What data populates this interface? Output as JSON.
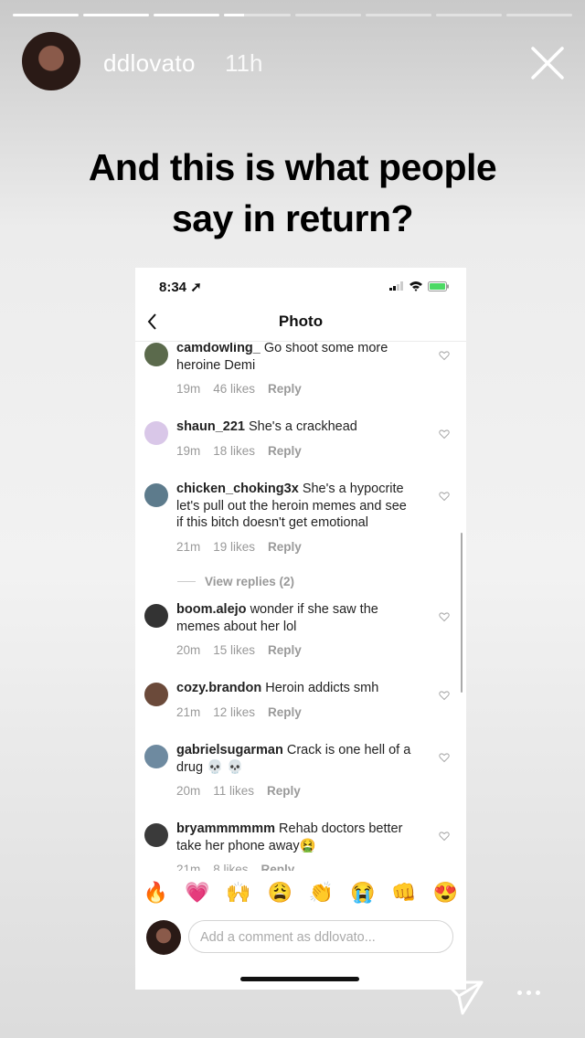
{
  "story": {
    "progress_segments": [
      1,
      1,
      1,
      0.3,
      0,
      0,
      0,
      0
    ],
    "username": "ddlovato",
    "time": "11h",
    "headline_line1": "And this is what people",
    "headline_line2": "say in return?"
  },
  "screenshot": {
    "status_time": "8:34",
    "nav_title": "Photo",
    "comments": [
      {
        "user": "camdowling_",
        "text": "Go shoot some more heroine Demi",
        "time": "19m",
        "likes": "46 likes",
        "reply": "Reply"
      },
      {
        "user": "shaun_221",
        "text": "She's a crackhead",
        "time": "19m",
        "likes": "18 likes",
        "reply": "Reply"
      },
      {
        "user": "chicken_choking3x",
        "text": "She's a hypocrite let's pull out the heroin memes and see if this bitch doesn't get emotional",
        "time": "21m",
        "likes": "19 likes",
        "reply": "Reply"
      },
      {
        "user": "boom.alejo",
        "text": "wonder if she saw the memes about her lol",
        "time": "20m",
        "likes": "15 likes",
        "reply": "Reply"
      },
      {
        "user": "cozy.brandon",
        "text": "Heroin addicts smh",
        "time": "21m",
        "likes": "12 likes",
        "reply": "Reply"
      },
      {
        "user": "gabrielsugarman",
        "text": "Crack is one hell of a drug 💀 💀",
        "time": "20m",
        "likes": "11 likes",
        "reply": "Reply"
      },
      {
        "user": "bryammmmmm",
        "text": "Rehab doctors better take her phone away🤮",
        "time": "21m",
        "likes": "8 likes",
        "reply": "Reply"
      }
    ],
    "view_replies": "View replies (2)",
    "emojis": [
      "🔥",
      "💗",
      "🙌",
      "😩",
      "👏",
      "😭",
      "👊",
      "😍"
    ],
    "comment_placeholder": "Add a comment as ddlovato..."
  },
  "colors": {
    "accent": "#ffffff",
    "text": "#222222",
    "muted": "#999999"
  }
}
